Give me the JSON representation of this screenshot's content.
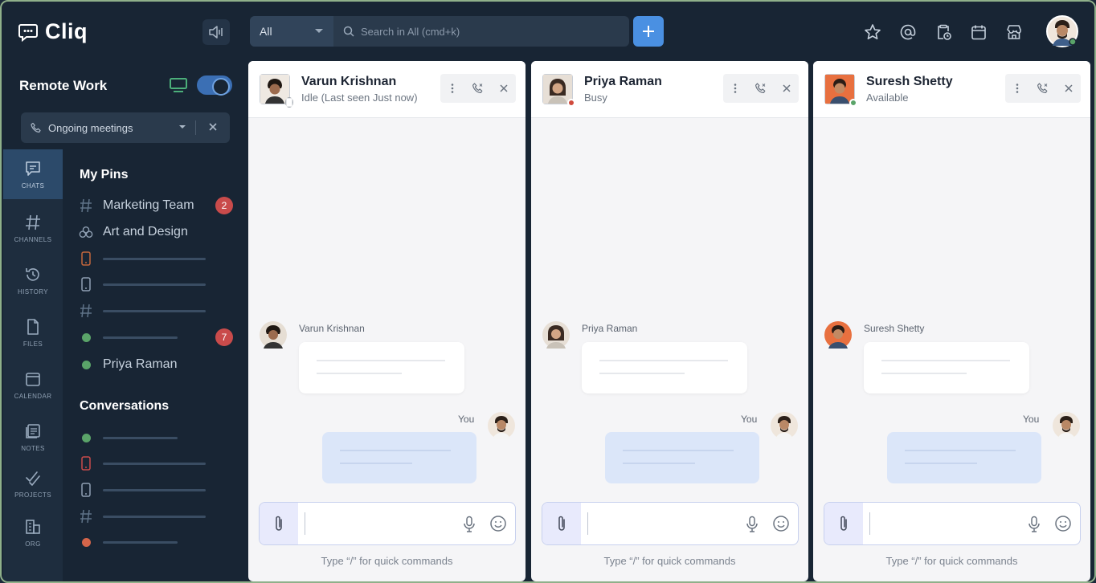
{
  "app": {
    "name": "Cliq"
  },
  "search": {
    "scope": "All",
    "placeholder": "Search in All (cmd+k)"
  },
  "workspace": {
    "title": "Remote Work",
    "meeting_label": "Ongoing meetings"
  },
  "rail": [
    {
      "label": "CHATS",
      "icon": "chat-icon",
      "active": true
    },
    {
      "label": "CHANNELS",
      "icon": "hash-icon"
    },
    {
      "label": "HISTORY",
      "icon": "history-icon"
    },
    {
      "label": "FILES",
      "icon": "file-icon"
    },
    {
      "label": "CALENDAR",
      "icon": "calendar-icon"
    },
    {
      "label": "NOTES",
      "icon": "notes-icon"
    },
    {
      "label": "PROJECTS",
      "icon": "projects-icon"
    },
    {
      "label": "ORG",
      "icon": "org-icon"
    }
  ],
  "pins": {
    "title": "My Pins",
    "items": [
      {
        "label": "Marketing Team",
        "icon": "hash-icon",
        "badge": "2"
      },
      {
        "label": "Art and Design",
        "icon": "group-icon"
      },
      {
        "label": "Priya Raman",
        "icon": "green-dot"
      }
    ],
    "unread_badge": "7"
  },
  "conversations": {
    "title": "Conversations"
  },
  "chats": [
    {
      "name": "Varun Krishnan",
      "status": "Idle (Last seen Just now)",
      "status_color": "#9aa0a8",
      "you_label": "You",
      "hint": "Type “/” for quick commands"
    },
    {
      "name": "Priya Raman",
      "status": "Busy",
      "status_color": "#d04b3d",
      "you_label": "You",
      "hint": "Type “/” for quick commands"
    },
    {
      "name": "Suresh Shetty",
      "status": "Available",
      "status_color": "#5aa469",
      "you_label": "You",
      "hint": "Type “/” for quick commands"
    }
  ],
  "colors": {
    "accent": "#4a90e2",
    "sidebar": "#182534",
    "badge": "#c94b4b",
    "online": "#5aa469"
  }
}
